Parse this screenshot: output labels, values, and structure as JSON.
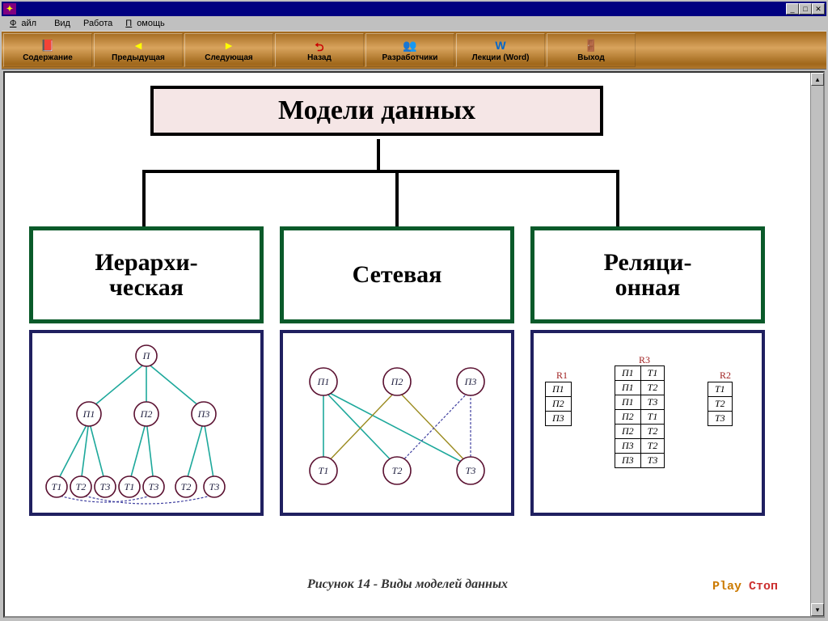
{
  "menu": {
    "file": "Файл",
    "view": "Вид",
    "work": "Работа",
    "help": "Помощь"
  },
  "toolbar": {
    "contents": "Содержание",
    "prev": "Предыдущая",
    "next": "Следующая",
    "back": "Назад",
    "devs": "Разработчики",
    "lectures": "Лекции (Word)",
    "exit": "Выход"
  },
  "diagram": {
    "title": "Модели данных",
    "col1": {
      "line1": "Иерархи-",
      "line2": "ческая"
    },
    "col2": "Сетевая",
    "col3": {
      "line1": "Реляци-",
      "line2": "онная"
    },
    "tree": {
      "root": "П",
      "p1": "П1",
      "p2": "П2",
      "p3": "П3",
      "t1": "Т1",
      "t2": "Т2",
      "t3": "Т3"
    },
    "net": {
      "p1": "П1",
      "p2": "П2",
      "p3": "П3",
      "t1": "Т1",
      "t2": "Т2",
      "t3": "Т3"
    },
    "rel": {
      "r1_name": "R1",
      "r2_name": "R2",
      "r3_name": "R3",
      "r1": [
        "П1",
        "П2",
        "П3"
      ],
      "r2": [
        "Т1",
        "Т2",
        "Т3"
      ],
      "r3": [
        [
          "П1",
          "Т1"
        ],
        [
          "П1",
          "Т2"
        ],
        [
          "П1",
          "Т3"
        ],
        [
          "П2",
          "Т1"
        ],
        [
          "П2",
          "Т2"
        ],
        [
          "П3",
          "Т2"
        ],
        [
          "П3",
          "Т3"
        ]
      ]
    }
  },
  "caption": "Рисунок 14 - Виды моделей данных",
  "play": "Play",
  "stop": "Стоп"
}
